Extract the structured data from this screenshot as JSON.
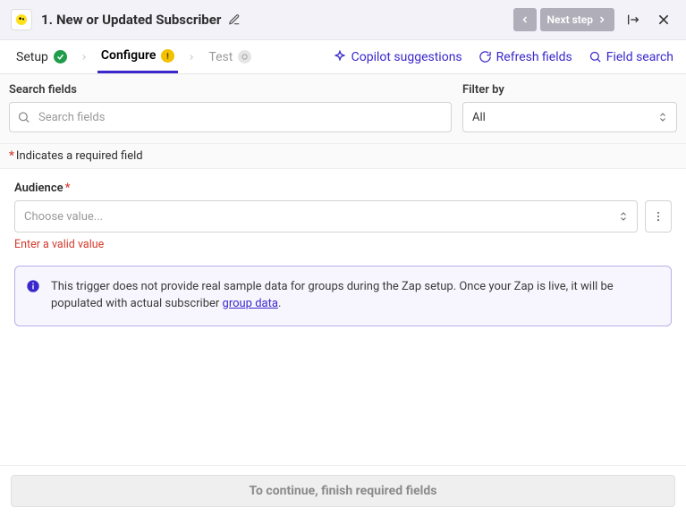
{
  "header": {
    "step_number": "1.",
    "step_title": "New or Updated Subscriber",
    "nav_next_label": "Next step"
  },
  "tabs": {
    "setup": "Setup",
    "configure": "Configure",
    "test": "Test",
    "copilot": "Copilot suggestions",
    "refresh": "Refresh fields",
    "field_search": "Field search"
  },
  "search": {
    "search_label": "Search fields",
    "search_placeholder": "Search fields",
    "filter_label": "Filter by",
    "filter_value": "All"
  },
  "required_note": "Indicates a required field",
  "audience": {
    "label": "Audience",
    "placeholder": "Choose value...",
    "error": "Enter a valid value"
  },
  "callout": {
    "text_before": "This trigger does not provide real sample data for groups during the Zap setup. Once your Zap is live, it will be populated with actual subscriber ",
    "link_text": "group data",
    "text_after": "."
  },
  "footer": {
    "continue_label": "To continue, finish required fields"
  }
}
